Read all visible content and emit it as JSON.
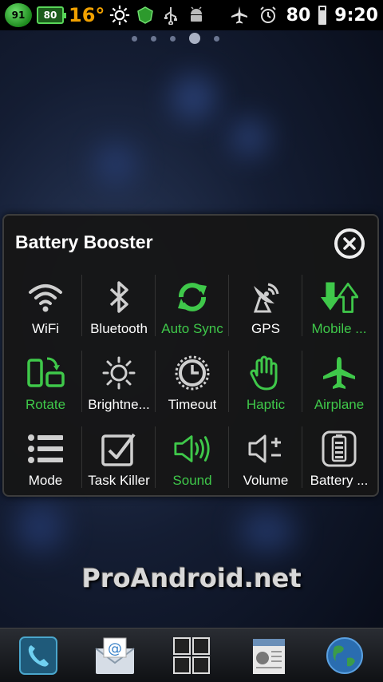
{
  "status_bar": {
    "cpu_value": "91",
    "battery_widget_value": "80",
    "temperature": "16°",
    "battery_percent": "80",
    "time": "9:20"
  },
  "panel": {
    "title": "Battery Booster",
    "toggles": [
      {
        "label": "WiFi",
        "icon": "wifi-icon",
        "on": false
      },
      {
        "label": "Bluetooth",
        "icon": "bluetooth-icon",
        "on": false
      },
      {
        "label": "Auto Sync",
        "icon": "sync-icon",
        "on": true
      },
      {
        "label": "GPS",
        "icon": "gps-icon",
        "on": false
      },
      {
        "label": "Mobile ...",
        "icon": "mobile-data-icon",
        "on": true
      },
      {
        "label": "Rotate",
        "icon": "rotate-icon",
        "on": true
      },
      {
        "label": "Brightne...",
        "icon": "brightness-icon",
        "on": false
      },
      {
        "label": "Timeout",
        "icon": "timeout-icon",
        "on": false
      },
      {
        "label": "Haptic",
        "icon": "haptic-icon",
        "on": true
      },
      {
        "label": "Airplane",
        "icon": "airplane-icon",
        "on": true
      },
      {
        "label": "Mode",
        "icon": "mode-icon",
        "on": false
      },
      {
        "label": "Task Killer",
        "icon": "task-killer-icon",
        "on": false
      },
      {
        "label": "Sound",
        "icon": "sound-icon",
        "on": true
      },
      {
        "label": "Volume",
        "icon": "volume-icon",
        "on": false
      },
      {
        "label": "Battery ...",
        "icon": "battery-icon",
        "on": false
      }
    ]
  },
  "watermark": "ProAndroid.net",
  "colors": {
    "accent_on": "#3fc84a",
    "icon_off": "#d0d0d0"
  }
}
